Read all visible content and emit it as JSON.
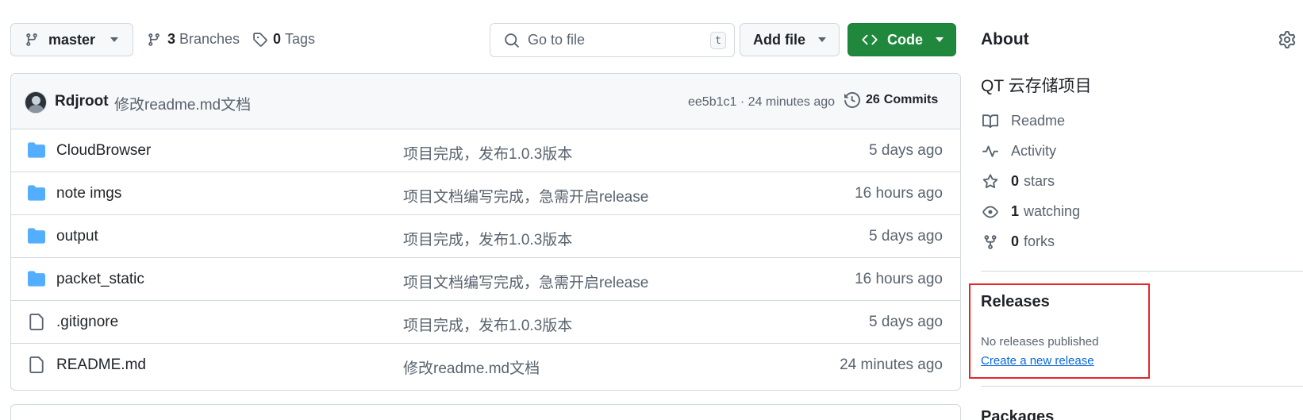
{
  "toolbar": {
    "branch": "master",
    "branches_count": "3",
    "branches_label": "Branches",
    "tags_count": "0",
    "tags_label": "Tags",
    "search_placeholder": "Go to file",
    "search_shortcut": "t",
    "add_file_label": "Add file",
    "code_label": "Code"
  },
  "latest_commit": {
    "author": "Rdjroot",
    "message": "修改readme.md文档",
    "sha_time": "ee5b1c1 · 24 minutes ago",
    "commits_count": "26",
    "commits_label": "Commits"
  },
  "files": [
    {
      "type": "folder",
      "name": "CloudBrowser",
      "message": "项目完成，发布1.0.3版本",
      "time": "5 days ago"
    },
    {
      "type": "folder",
      "name": "note imgs",
      "message": "项目文档编写完成，急需开启release",
      "time": "16 hours ago"
    },
    {
      "type": "folder",
      "name": "output",
      "message": "项目完成，发布1.0.3版本",
      "time": "5 days ago"
    },
    {
      "type": "folder",
      "name": "packet_static",
      "message": "项目文档编写完成，急需开启release",
      "time": "16 hours ago"
    },
    {
      "type": "file",
      "name": ".gitignore",
      "message": "项目完成，发布1.0.3版本",
      "time": "5 days ago"
    },
    {
      "type": "file",
      "name": "README.md",
      "message": "修改readme.md文档",
      "time": "24 minutes ago"
    }
  ],
  "about": {
    "title": "About",
    "description": "QT 云存储项目",
    "readme": "Readme",
    "activity": "Activity",
    "stars_count": "0",
    "stars_label": "stars",
    "watching_count": "1",
    "watching_label": "watching",
    "forks_count": "0",
    "forks_label": "forks"
  },
  "releases": {
    "title": "Releases",
    "empty_text": "No releases published",
    "create_link": "Create a new release"
  },
  "packages": {
    "title": "Packages"
  },
  "colors": {
    "accent_green": "#1f883d",
    "link_blue": "#0969da",
    "folder_blue": "#54aeff",
    "highlight_red": "#e5262a"
  }
}
